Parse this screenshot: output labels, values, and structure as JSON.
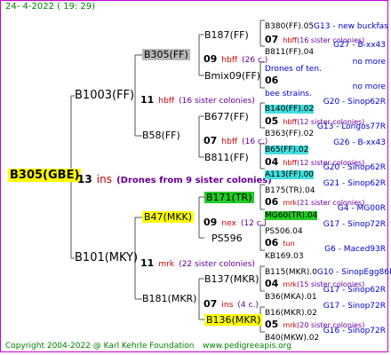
{
  "header": {
    "date": "24- 4-2022 ( 19: 29)"
  },
  "footer": {
    "copyright": "Copyright 2004-2022 @ Karl Kehrle Foundation",
    "site": "www.pedigreeapis.org"
  },
  "root": {
    "name": "B305(GBE)",
    "gen": "13",
    "code": "ins",
    "note": "(Drones from 9 sister colonies)"
  },
  "tree": {
    "g1a": {
      "name": "B1003(FF)",
      "gen": "11",
      "code": "hbff",
      "note": "(16 sister colonies)"
    },
    "g1b": {
      "name": "B101(MKY)",
      "gen": "11",
      "code": "mrk",
      "note": "(22 sister colonies)"
    },
    "g2a": {
      "name": "B305(FF)",
      "gen": "09",
      "code": "hbff",
      "note": "(26 c.)"
    },
    "g2b": {
      "name": "B58(FF)",
      "gen": "07",
      "code": "hbff",
      "note": "(16 c.)"
    },
    "g2c": {
      "name": "B47(MKK)",
      "gen": "09",
      "code": "nex",
      "note": "(12 c.)"
    },
    "g2d": {
      "name": "B181(MKR)",
      "gen": "07",
      "code": "ins",
      "note": "(4 c.)"
    },
    "g3": [
      {
        "name": "B187(FF)"
      },
      {
        "name": "Bmix09(FF)"
      },
      {
        "name": "B677(FF)"
      },
      {
        "name": "B811(FF)"
      },
      {
        "name": "B171(TR)"
      },
      {
        "name": "PS596"
      },
      {
        "name": "B137(MKR)"
      },
      {
        "name": "B136(MKR)"
      }
    ],
    "g3_gens": [
      {
        "gen": "06",
        "code": "",
        "note": ""
      },
      {
        "gen": "05",
        "code": "hbff",
        "note": "(12 sister colonies)"
      },
      {
        "gen": "04",
        "code": "hbff",
        "note": "(12 sister colonies)"
      },
      {
        "gen": "06",
        "code": "mrk",
        "note": "(21 sister colonies)"
      },
      {
        "gen": "06",
        "code": "tun",
        "note": ""
      },
      {
        "gen": "04",
        "code": "mrk",
        "note": "(15 sister colonies)"
      },
      {
        "gen": "05",
        "code": "mrk",
        "note": "(20 sister colonies)"
      }
    ],
    "g4": [
      {
        "name": "B380(FF).05",
        "note": "G13 - new buckfas"
      },
      {
        "gen": "07",
        "code": "hbff",
        "note": "(16 sister colonies)"
      },
      {
        "name": "B811(FF).04",
        "note": "G27 - B-xx43"
      },
      {
        "name": "Drones of ten.",
        "note": "no more"
      },
      {
        "name": "bee strains.",
        "note": "no more"
      },
      {
        "name": "B140(FF).02",
        "note": "G20 - Sinop62R"
      },
      {
        "name": "B363(FF).02",
        "note": "G13 - Longos77R"
      },
      {
        "name": "B65(FF).02",
        "note": "G26 - B-xx43"
      },
      {
        "name": "A113(FF).00",
        "note": "G20 - Sinop62R"
      },
      {
        "name": "B175(TR).04",
        "note": "G21 - Sinop62R"
      },
      {
        "name": "MG60(TR).04",
        "note": "G4 - MG00R"
      },
      {
        "name": "PS506.04",
        "note": "G17 - Sinop72R"
      },
      {
        "name": "KB169.03",
        "note": "G6 - Maced93R"
      },
      {
        "name": "B115(MKR).0",
        "note": "G10 - SinopEgg86R"
      },
      {
        "name": "B36(MKA).01",
        "note": "G17 - Sinop62R"
      },
      {
        "name": "B16(MKR).02",
        "note": "G17 - Sinop72R"
      },
      {
        "name": "B40(MKW).02",
        "note": "G16 - Sinop72R"
      }
    ]
  }
}
